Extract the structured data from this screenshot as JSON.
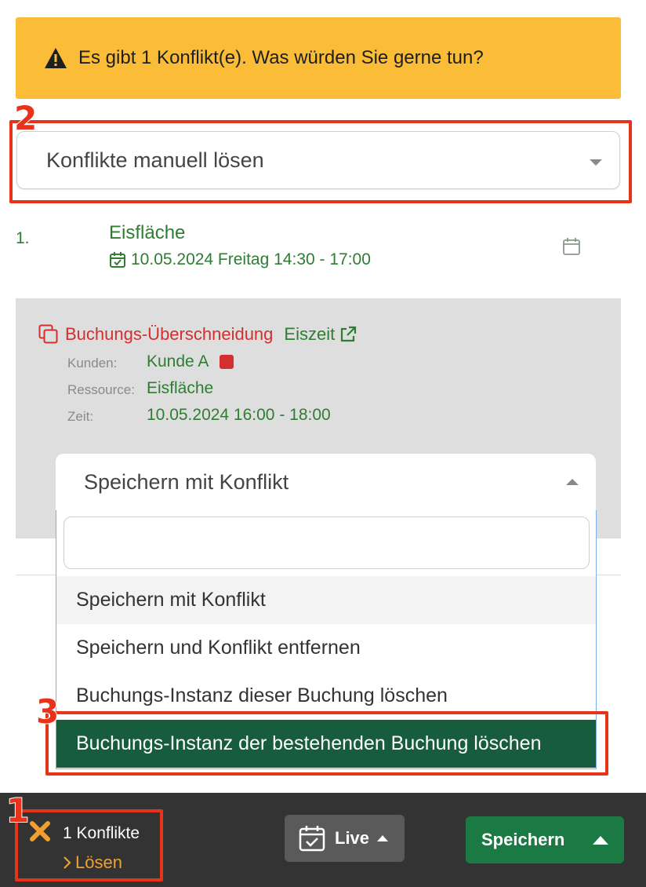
{
  "alert": {
    "message": "Es gibt 1 Konflikt(e). Was würden Sie gerne tun?",
    "color": "#fbbc37"
  },
  "annotations": [
    "2",
    "3",
    "1"
  ],
  "resolution_select": {
    "value": "Konflikte manuell lösen"
  },
  "booking": {
    "number": "1.",
    "resource": "Eisfläche",
    "datetime": "10.05.2024 Freitag 14:30 - 17:00"
  },
  "conflict": {
    "type": "Buchungs-Überschneidung",
    "booking_name": "Eiszeit",
    "customer_label": "Kunden:",
    "customer_value": "Kunde A",
    "resource_label": "Ressource:",
    "resource_value": "Eisfläche",
    "time_label": "Zeit:",
    "time_value": "10.05.2024 16:00 - 18:00"
  },
  "action_select": {
    "value": "Speichern mit Konflikt",
    "search_value": "",
    "options": [
      "Speichern mit Konflikt",
      "Speichern und Konflikt entfernen",
      "Buchungs-Instanz dieser Buchung löschen",
      "Buchungs-Instanz der bestehenden Buchung löschen"
    ]
  },
  "bottom_bar": {
    "conflict_count": "1 Konflikte",
    "resolve_label": "Lösen",
    "live_label": "Live",
    "save_label": "Speichern"
  },
  "colors": {
    "accent_green": "#2e7d32",
    "conflict_red": "#d32f2f",
    "selected_option": "#175c3c",
    "save_button": "#1b7a44",
    "annotation_red": "#e8321a"
  },
  "icons": [
    "warning-icon",
    "calendar-check-icon",
    "calendar-icon",
    "copy-icon",
    "external-link-icon",
    "close-x-icon",
    "chevron-right-icon",
    "calendar-live-icon",
    "caret-up-icon",
    "caret-down-icon"
  ]
}
